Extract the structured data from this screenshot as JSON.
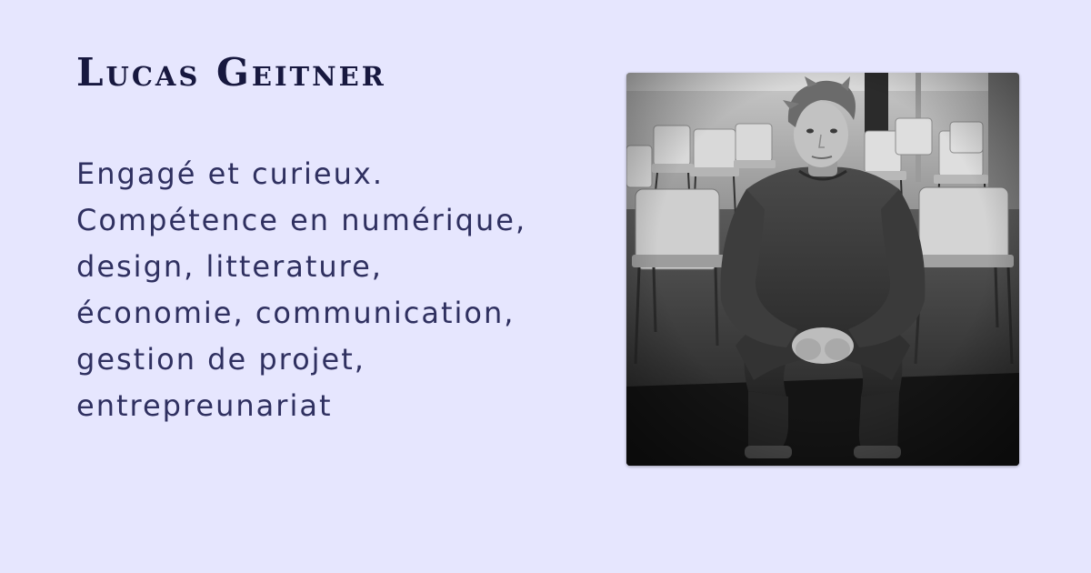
{
  "profile": {
    "name": "Lucas Geitner",
    "bio_lines": [
      "Engagé et curieux.",
      "Compétence en numérique,",
      "design, litterature,",
      "économie, communication,",
      "gestion de projet,",
      "entrepreunariat"
    ]
  },
  "colors": {
    "background": "#e6e6fe",
    "name_text": "#17183f",
    "bio_text": "#2f3060"
  }
}
